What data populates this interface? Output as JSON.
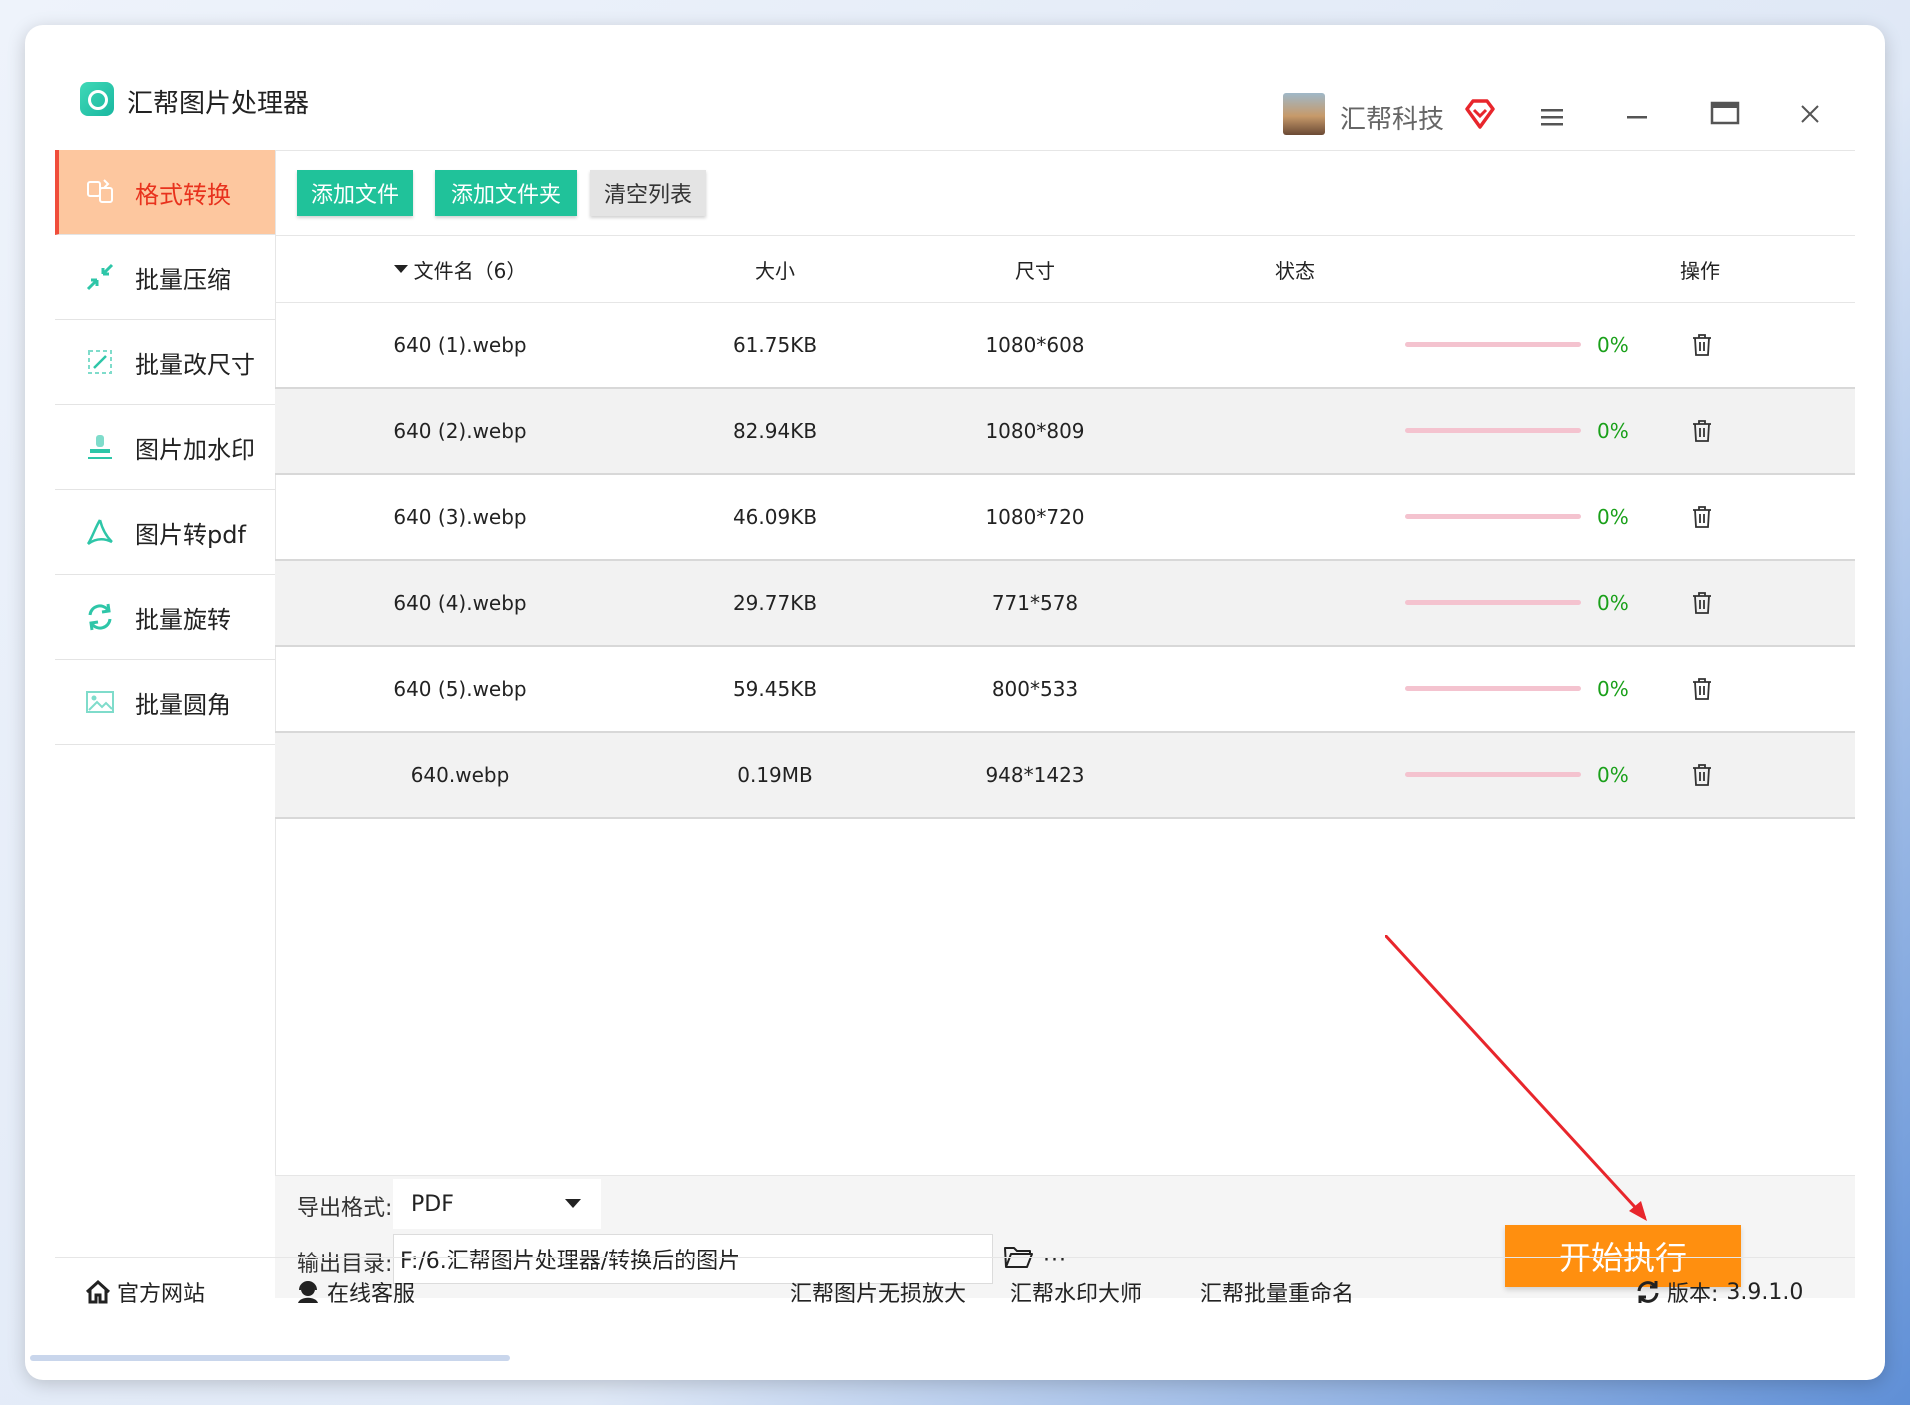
{
  "app": {
    "title": "汇帮图片处理器",
    "user_name": "汇帮科技"
  },
  "sidebar": {
    "items": [
      {
        "label": "格式转换",
        "icon": "convert-icon",
        "active": true
      },
      {
        "label": "批量压缩",
        "icon": "compress-icon",
        "active": false
      },
      {
        "label": "批量改尺寸",
        "icon": "resize-icon",
        "active": false
      },
      {
        "label": "图片加水印",
        "icon": "watermark-icon",
        "active": false
      },
      {
        "label": "图片转pdf",
        "icon": "pdf-icon",
        "active": false
      },
      {
        "label": "批量旋转",
        "icon": "rotate-icon",
        "active": false
      },
      {
        "label": "批量圆角",
        "icon": "rounded-corner-icon",
        "active": false
      }
    ]
  },
  "toolbar": {
    "add_file": "添加文件",
    "add_folder": "添加文件夹",
    "clear_list": "清空列表"
  },
  "table": {
    "headers": {
      "filename": "文件名（6）",
      "size": "大小",
      "dimensions": "尺寸",
      "status": "状态",
      "actions": "操作"
    },
    "rows": [
      {
        "filename": "640 (1).webp",
        "size": "61.75KB",
        "dimensions": "1080*608",
        "progress": "0%"
      },
      {
        "filename": "640 (2).webp",
        "size": "82.94KB",
        "dimensions": "1080*809",
        "progress": "0%"
      },
      {
        "filename": "640 (3).webp",
        "size": "46.09KB",
        "dimensions": "1080*720",
        "progress": "0%"
      },
      {
        "filename": "640 (4).webp",
        "size": "29.77KB",
        "dimensions": "771*578",
        "progress": "0%"
      },
      {
        "filename": "640 (5).webp",
        "size": "59.45KB",
        "dimensions": "800*533",
        "progress": "0%"
      },
      {
        "filename": "640.webp",
        "size": "0.19MB",
        "dimensions": "948*1423",
        "progress": "0%"
      }
    ]
  },
  "settings": {
    "format_label": "导出格式:",
    "format_value": "PDF",
    "output_label": "输出目录:",
    "output_path": "F:/6.汇帮图片处理器/转换后的图片",
    "more": "···",
    "start": "开始执行"
  },
  "footer": {
    "website": "官方网站",
    "support": "在线客服",
    "link1": "汇帮图片无损放大",
    "link2": "汇帮水印大师",
    "link3": "汇帮批量重命名",
    "version_label": "版本:",
    "version": "3.9.1.0"
  },
  "colors": {
    "accent_green": "#20c29a",
    "active_bg": "#fdc79f",
    "active_text": "#e8321d",
    "start_orange": "#ff8f0f",
    "progress_track": "#f4c3cf",
    "progress_text": "#1aa01a"
  }
}
